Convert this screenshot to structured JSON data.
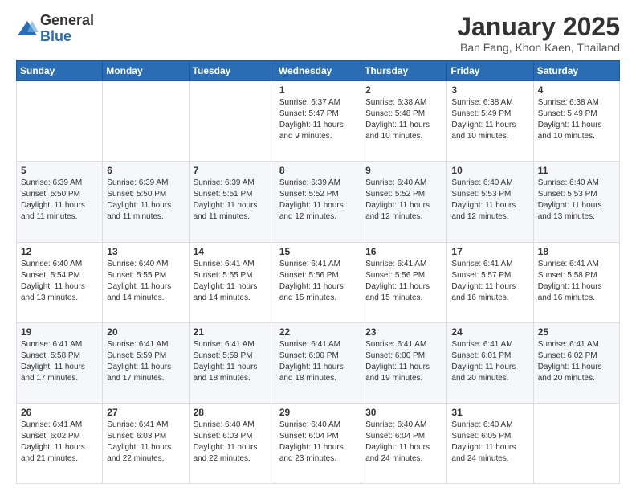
{
  "logo": {
    "general": "General",
    "blue": "Blue"
  },
  "title": "January 2025",
  "subtitle": "Ban Fang, Khon Kaen, Thailand",
  "days_of_week": [
    "Sunday",
    "Monday",
    "Tuesday",
    "Wednesday",
    "Thursday",
    "Friday",
    "Saturday"
  ],
  "weeks": [
    [
      {
        "day": "",
        "info": ""
      },
      {
        "day": "",
        "info": ""
      },
      {
        "day": "",
        "info": ""
      },
      {
        "day": "1",
        "info": "Sunrise: 6:37 AM\nSunset: 5:47 PM\nDaylight: 11 hours\nand 9 minutes."
      },
      {
        "day": "2",
        "info": "Sunrise: 6:38 AM\nSunset: 5:48 PM\nDaylight: 11 hours\nand 10 minutes."
      },
      {
        "day": "3",
        "info": "Sunrise: 6:38 AM\nSunset: 5:49 PM\nDaylight: 11 hours\nand 10 minutes."
      },
      {
        "day": "4",
        "info": "Sunrise: 6:38 AM\nSunset: 5:49 PM\nDaylight: 11 hours\nand 10 minutes."
      }
    ],
    [
      {
        "day": "5",
        "info": "Sunrise: 6:39 AM\nSunset: 5:50 PM\nDaylight: 11 hours\nand 11 minutes."
      },
      {
        "day": "6",
        "info": "Sunrise: 6:39 AM\nSunset: 5:50 PM\nDaylight: 11 hours\nand 11 minutes."
      },
      {
        "day": "7",
        "info": "Sunrise: 6:39 AM\nSunset: 5:51 PM\nDaylight: 11 hours\nand 11 minutes."
      },
      {
        "day": "8",
        "info": "Sunrise: 6:39 AM\nSunset: 5:52 PM\nDaylight: 11 hours\nand 12 minutes."
      },
      {
        "day": "9",
        "info": "Sunrise: 6:40 AM\nSunset: 5:52 PM\nDaylight: 11 hours\nand 12 minutes."
      },
      {
        "day": "10",
        "info": "Sunrise: 6:40 AM\nSunset: 5:53 PM\nDaylight: 11 hours\nand 12 minutes."
      },
      {
        "day": "11",
        "info": "Sunrise: 6:40 AM\nSunset: 5:53 PM\nDaylight: 11 hours\nand 13 minutes."
      }
    ],
    [
      {
        "day": "12",
        "info": "Sunrise: 6:40 AM\nSunset: 5:54 PM\nDaylight: 11 hours\nand 13 minutes."
      },
      {
        "day": "13",
        "info": "Sunrise: 6:40 AM\nSunset: 5:55 PM\nDaylight: 11 hours\nand 14 minutes."
      },
      {
        "day": "14",
        "info": "Sunrise: 6:41 AM\nSunset: 5:55 PM\nDaylight: 11 hours\nand 14 minutes."
      },
      {
        "day": "15",
        "info": "Sunrise: 6:41 AM\nSunset: 5:56 PM\nDaylight: 11 hours\nand 15 minutes."
      },
      {
        "day": "16",
        "info": "Sunrise: 6:41 AM\nSunset: 5:56 PM\nDaylight: 11 hours\nand 15 minutes."
      },
      {
        "day": "17",
        "info": "Sunrise: 6:41 AM\nSunset: 5:57 PM\nDaylight: 11 hours\nand 16 minutes."
      },
      {
        "day": "18",
        "info": "Sunrise: 6:41 AM\nSunset: 5:58 PM\nDaylight: 11 hours\nand 16 minutes."
      }
    ],
    [
      {
        "day": "19",
        "info": "Sunrise: 6:41 AM\nSunset: 5:58 PM\nDaylight: 11 hours\nand 17 minutes."
      },
      {
        "day": "20",
        "info": "Sunrise: 6:41 AM\nSunset: 5:59 PM\nDaylight: 11 hours\nand 17 minutes."
      },
      {
        "day": "21",
        "info": "Sunrise: 6:41 AM\nSunset: 5:59 PM\nDaylight: 11 hours\nand 18 minutes."
      },
      {
        "day": "22",
        "info": "Sunrise: 6:41 AM\nSunset: 6:00 PM\nDaylight: 11 hours\nand 18 minutes."
      },
      {
        "day": "23",
        "info": "Sunrise: 6:41 AM\nSunset: 6:00 PM\nDaylight: 11 hours\nand 19 minutes."
      },
      {
        "day": "24",
        "info": "Sunrise: 6:41 AM\nSunset: 6:01 PM\nDaylight: 11 hours\nand 20 minutes."
      },
      {
        "day": "25",
        "info": "Sunrise: 6:41 AM\nSunset: 6:02 PM\nDaylight: 11 hours\nand 20 minutes."
      }
    ],
    [
      {
        "day": "26",
        "info": "Sunrise: 6:41 AM\nSunset: 6:02 PM\nDaylight: 11 hours\nand 21 minutes."
      },
      {
        "day": "27",
        "info": "Sunrise: 6:41 AM\nSunset: 6:03 PM\nDaylight: 11 hours\nand 22 minutes."
      },
      {
        "day": "28",
        "info": "Sunrise: 6:40 AM\nSunset: 6:03 PM\nDaylight: 11 hours\nand 22 minutes."
      },
      {
        "day": "29",
        "info": "Sunrise: 6:40 AM\nSunset: 6:04 PM\nDaylight: 11 hours\nand 23 minutes."
      },
      {
        "day": "30",
        "info": "Sunrise: 6:40 AM\nSunset: 6:04 PM\nDaylight: 11 hours\nand 24 minutes."
      },
      {
        "day": "31",
        "info": "Sunrise: 6:40 AM\nSunset: 6:05 PM\nDaylight: 11 hours\nand 24 minutes."
      },
      {
        "day": "",
        "info": ""
      }
    ]
  ]
}
